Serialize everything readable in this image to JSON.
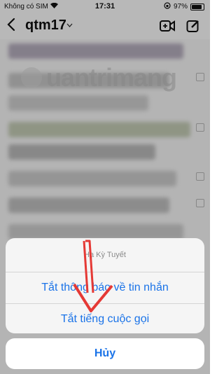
{
  "status_bar": {
    "carrier": "Không có SIM",
    "time": "17:31",
    "battery": "97%"
  },
  "nav": {
    "title": "qtm17"
  },
  "watermark": {
    "text": "uantrimang"
  },
  "action_sheet": {
    "title": "Hạ Kỳ Tuyết",
    "options": [
      "Tắt thông báo về tin nhắn",
      "Tắt tiếng cuộc gọi"
    ],
    "cancel": "Hủy"
  },
  "colors": {
    "action": "#1a73e8",
    "annotation": "#e53935"
  }
}
